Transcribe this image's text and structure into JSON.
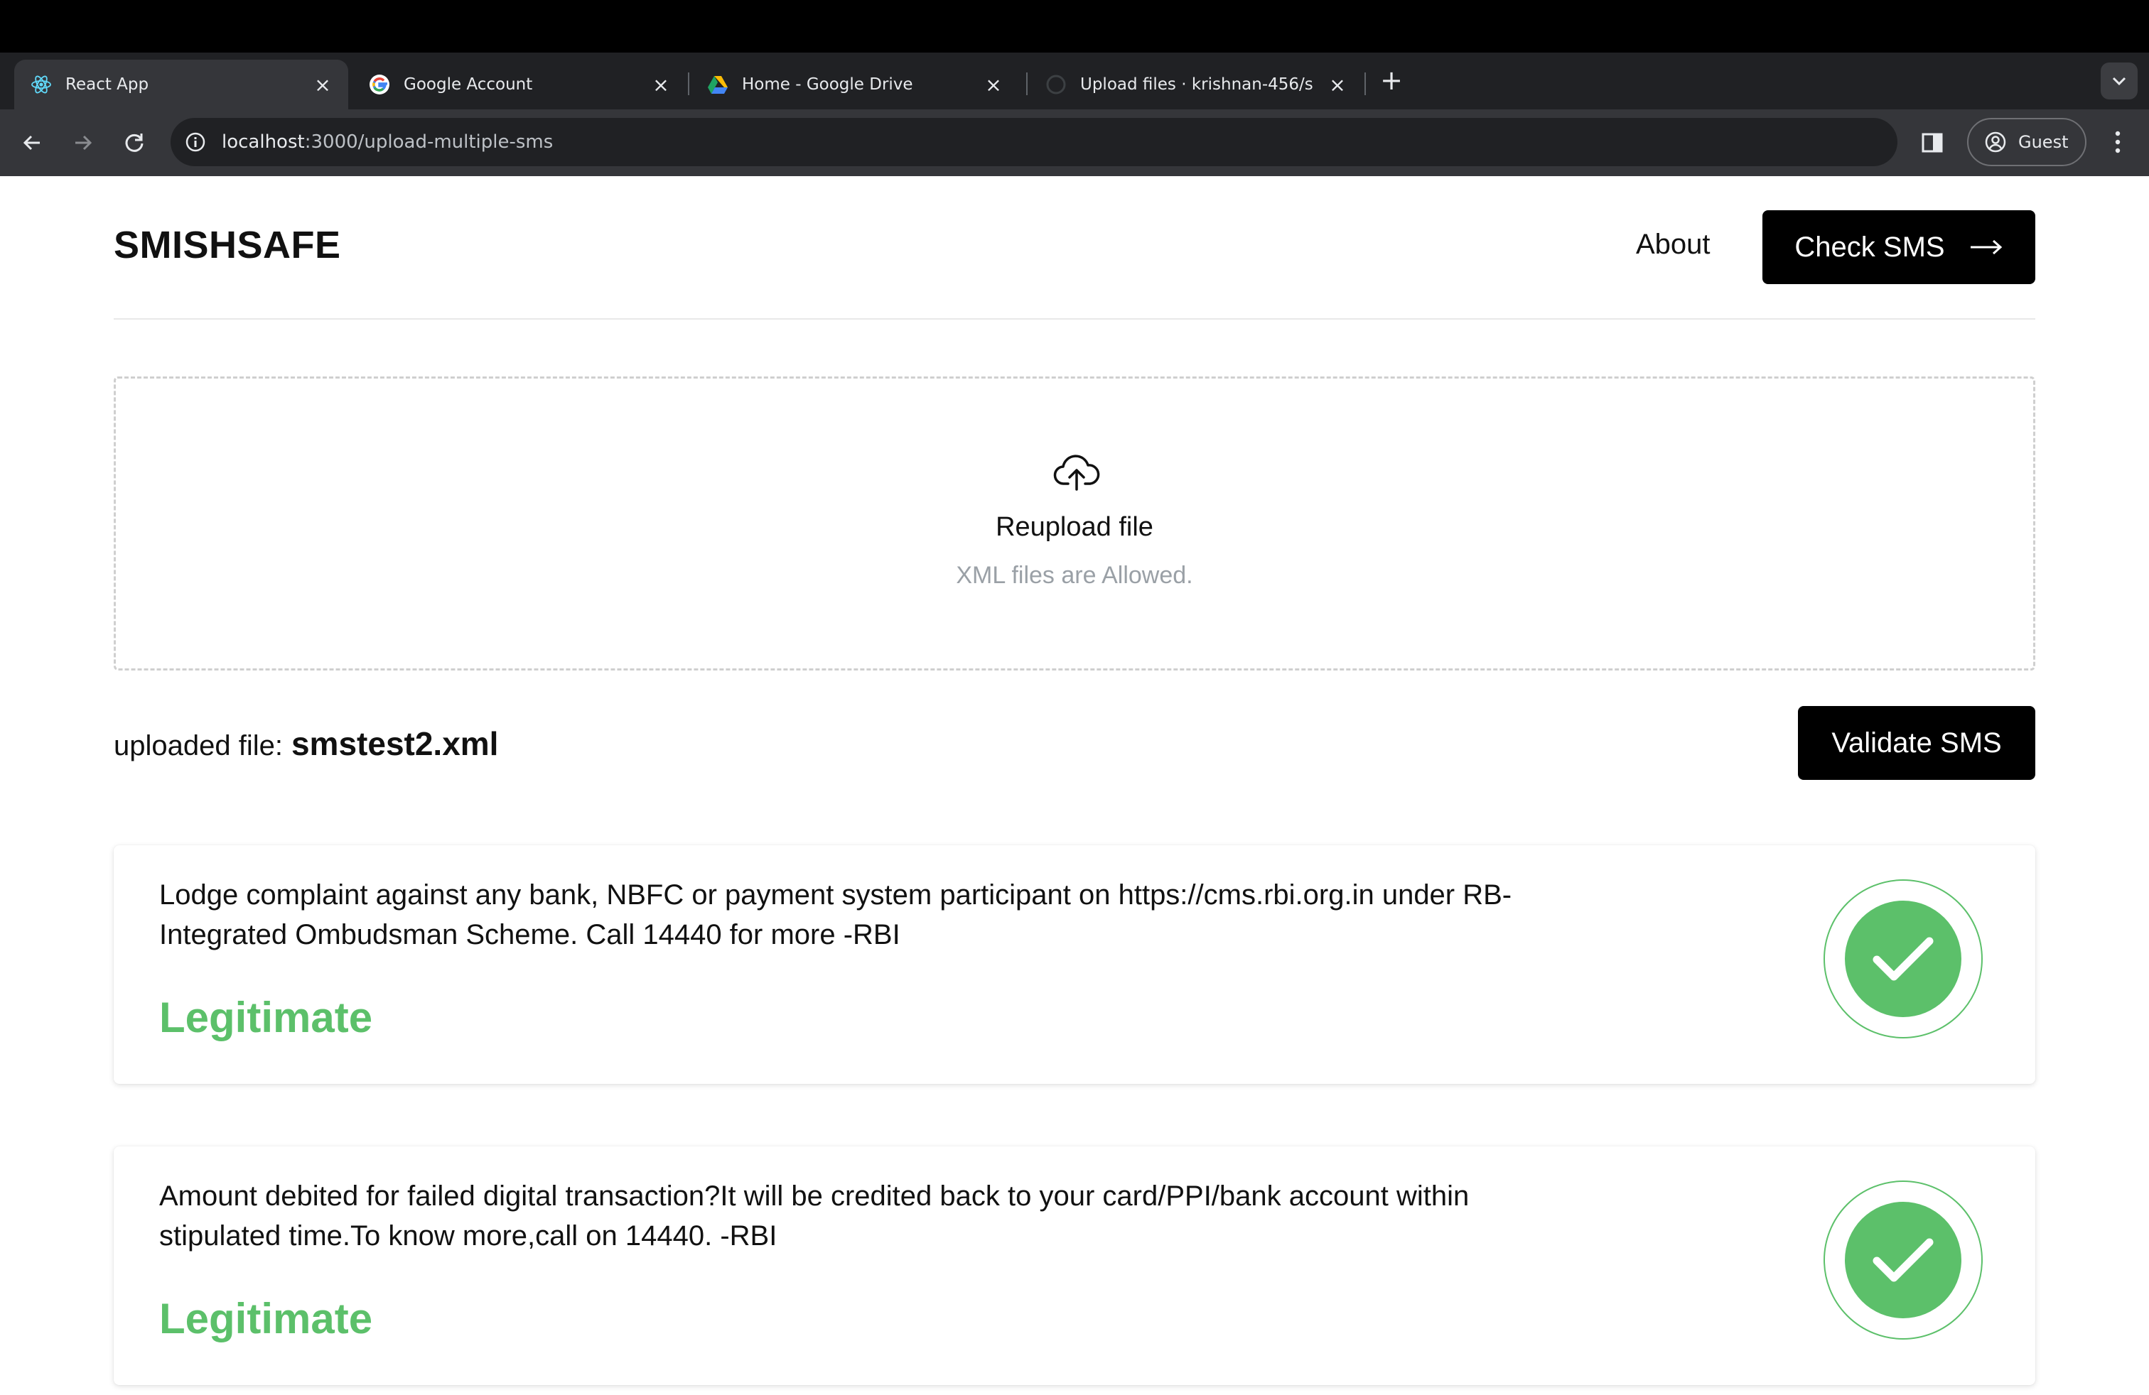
{
  "browser": {
    "tabs": [
      {
        "title": "React App",
        "icon": "react-icon",
        "active": true
      },
      {
        "title": "Google Account",
        "icon": "google-icon",
        "active": false
      },
      {
        "title": "Home - Google Drive",
        "icon": "google-drive-icon",
        "active": false
      },
      {
        "title": "Upload files · krishnan-456/s",
        "icon": "github-icon",
        "active": false
      }
    ],
    "url_host": "localhost",
    "url_path": ":3000/upload-multiple-sms",
    "profile_label": "Guest"
  },
  "header": {
    "brand": "SMISHSAFE",
    "about_label": "About",
    "check_sms_label": "Check SMS"
  },
  "upload": {
    "title": "Reupload file",
    "subtitle": "XML files are Allowed.",
    "uploaded_prefix": "uploaded file:",
    "file_name": "smstest2.xml",
    "validate_label": "Validate SMS"
  },
  "results": [
    {
      "message": "Lodge complaint against any bank, NBFC or payment system participant on https://cms.rbi.org.in under RB-Integrated Ombudsman Scheme. Call 14440 for more -RBI",
      "verdict": "Legitimate"
    },
    {
      "message": "Amount debited for failed digital transaction?It will be credited back to your card/PPI/bank account within stipulated time.To know more,call on 14440. -RBI",
      "verdict": "Legitimate"
    }
  ],
  "colors": {
    "accent_green": "#5cc06a",
    "button_black": "#000000",
    "chrome_dark": "#202124"
  }
}
